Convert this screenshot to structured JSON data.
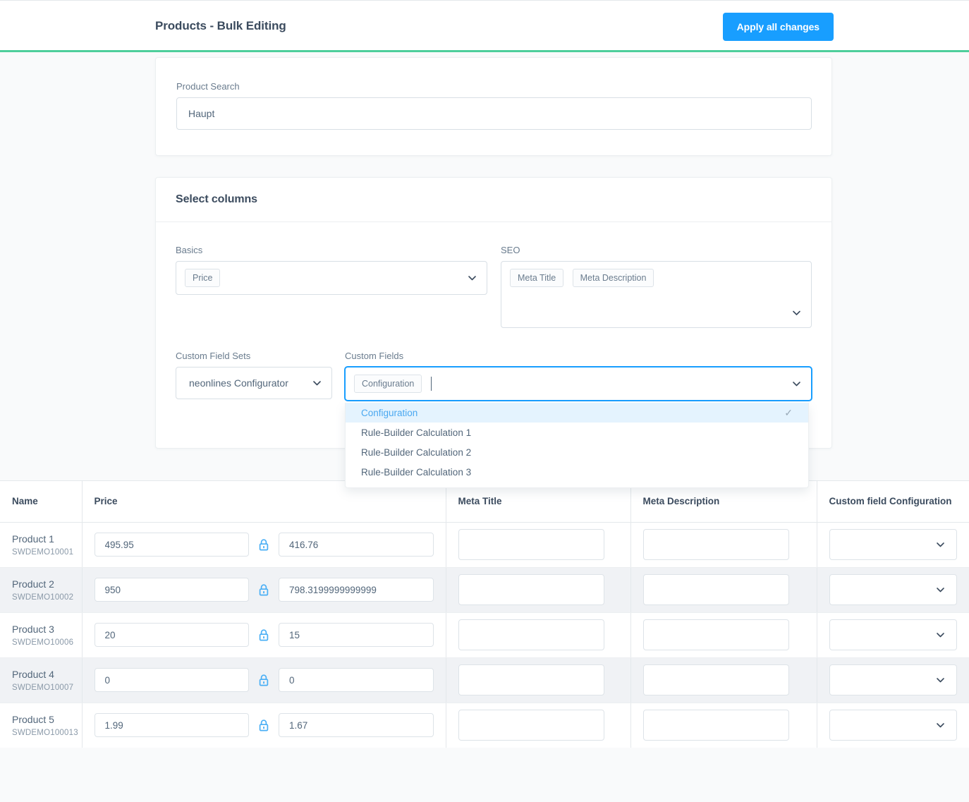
{
  "header": {
    "title": "Products - Bulk Editing",
    "apply_button": "Apply all changes"
  },
  "search_card": {
    "label": "Product Search",
    "value": "Haupt",
    "placeholder": ""
  },
  "columns_card": {
    "title": "Select columns",
    "basics": {
      "label": "Basics",
      "chips": [
        "Price"
      ]
    },
    "seo": {
      "label": "SEO",
      "chips": [
        "Meta Title",
        "Meta Description"
      ]
    },
    "custom_field_sets": {
      "label": "Custom Field Sets",
      "value": "neonlines Configurator"
    },
    "custom_fields": {
      "label": "Custom Fields",
      "chips": [
        "Configuration"
      ],
      "dropdown_options": [
        {
          "label": "Configuration",
          "selected": true
        },
        {
          "label": "Rule-Builder Calculation 1",
          "selected": false
        },
        {
          "label": "Rule-Builder Calculation 2",
          "selected": false
        },
        {
          "label": "Rule-Builder Calculation 3",
          "selected": false
        }
      ],
      "check_glyph": "✓"
    }
  },
  "table": {
    "columns": [
      "Name",
      "Price",
      "Meta Title",
      "Meta Description",
      "Custom field Configuration"
    ],
    "rows": [
      {
        "name": "Product 1",
        "sku": "SWDEMO10001",
        "price_gross": "495.95",
        "price_net": "416.76",
        "meta_title": "",
        "meta_description": "",
        "custom_field_configuration": ""
      },
      {
        "name": "Product 2",
        "sku": "SWDEMO10002",
        "price_gross": "950",
        "price_net": "798.3199999999999",
        "meta_title": "",
        "meta_description": "",
        "custom_field_configuration": ""
      },
      {
        "name": "Product 3",
        "sku": "SWDEMO10006",
        "price_gross": "20",
        "price_net": "15",
        "meta_title": "",
        "meta_description": "",
        "custom_field_configuration": ""
      },
      {
        "name": "Product 4",
        "sku": "SWDEMO10007",
        "price_gross": "0",
        "price_net": "0",
        "meta_title": "",
        "meta_description": "",
        "custom_field_configuration": ""
      },
      {
        "name": "Product 5",
        "sku": "SWDEMO100013",
        "price_gross": "1.99",
        "price_net": "1.67",
        "meta_title": "",
        "meta_description": "",
        "custom_field_configuration": ""
      }
    ]
  },
  "colors": {
    "accent_green": "#4ece9b",
    "primary_blue": "#189eff",
    "lock_blue": "#4aaff5",
    "text_dark": "#3b4b5e",
    "text_body": "#52667a",
    "row_alt": "#f0f2f5",
    "page_bg": "#f9fafb"
  }
}
